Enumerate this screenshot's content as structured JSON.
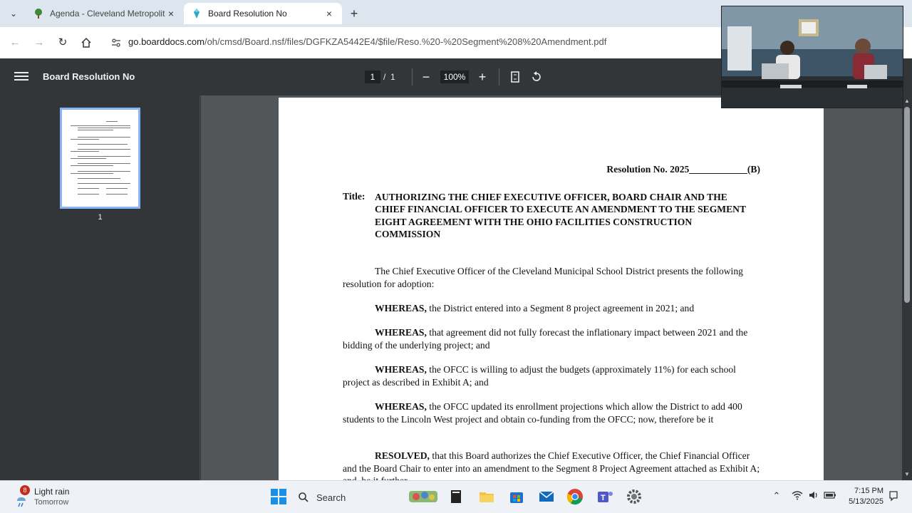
{
  "browser": {
    "tabs": [
      {
        "title": "Agenda - Cleveland Metropolit",
        "active": false
      },
      {
        "title": "Board Resolution No",
        "active": true
      }
    ],
    "url_domain": "go.boarddocs.com",
    "url_rest": "/oh/cmsd/Board.nsf/files/DGFKZA5442E4/$file/Reso.%20-%20Segment%208%20Amendment.pdf"
  },
  "pdf_toolbar": {
    "title": "Board Resolution No",
    "current_page": "1",
    "page_sep": "/",
    "total_pages": "1",
    "zoom": "100%"
  },
  "sidebar": {
    "thumbnail_label": "1"
  },
  "document": {
    "resolution_number": "Resolution No. 2025____________(B)",
    "title_label": "Title:",
    "title_text": "AUTHORIZING THE CHIEF EXECUTIVE OFFICER, BOARD CHAIR AND THE CHIEF FINANCIAL OFFICER TO EXECUTE AN AMENDMENT TO THE SEGMENT EIGHT AGREEMENT WITH THE OHIO FACILITIES CONSTRUCTION COMMISSION",
    "intro": "The Chief Executive Officer of the Cleveland Municipal School District presents the following resolution for adoption:",
    "whereas_1_lead": "WHEREAS,",
    "whereas_1": " the District entered into a Segment 8 project agreement in 2021; and",
    "whereas_2_lead": "WHEREAS,",
    "whereas_2": " that agreement did not fully forecast the inflationary impact between 2021 and the bidding of the underlying project; and",
    "whereas_3_lead": "WHEREAS,",
    "whereas_3": " the OFCC is willing to adjust the budgets (approximately 11%) for each school project as described in Exhibit A; and",
    "whereas_4_lead": "WHEREAS,",
    "whereas_4": " the OFCC updated its enrollment projections which allow the District to add 400 students to the Lincoln West project and obtain co-funding from the OFCC; now, therefore be it",
    "resolved_lead": "RESOLVED,",
    "resolved": " that this Board authorizes the Chief Executive Officer, the Chief Financial Officer and the Board Chair to enter into an amendment to the Segment 8 Project Agreement attached as Exhibit A; and, be it further"
  },
  "taskbar": {
    "weather_badge": "8",
    "weather_title": "Light rain",
    "weather_sub": "Tomorrow",
    "search_label": "Search",
    "time": "7:15 PM",
    "date": "5/13/2025"
  },
  "colors": {
    "pdf_bg": "#525659",
    "toolbar_bg": "#323639",
    "accent": "#8ab4f8"
  }
}
